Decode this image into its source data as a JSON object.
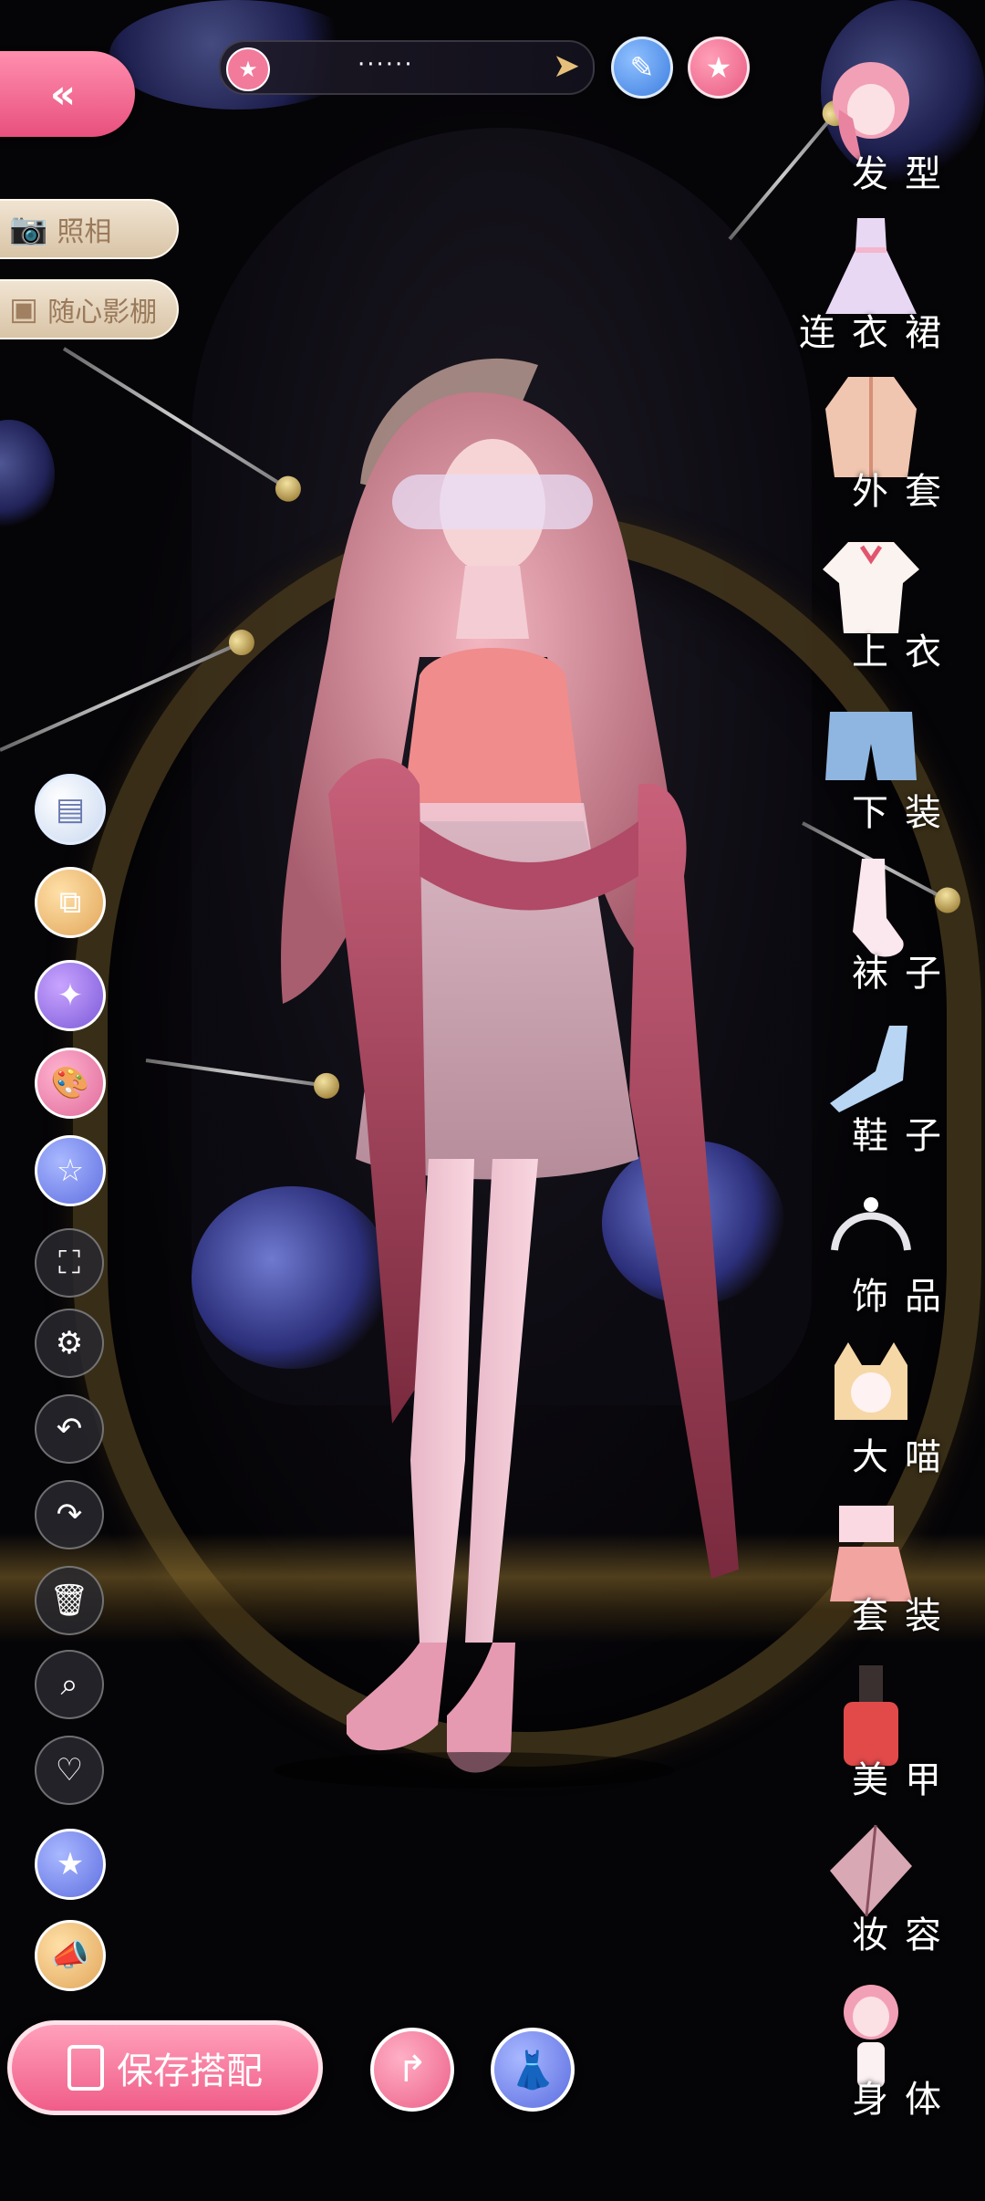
{
  "top_bar": {
    "back_icon": "«",
    "star_icon": "★",
    "outfit_name": "······",
    "arrow_icon": "➤",
    "edit_icon": "✎",
    "favorite_icon": "★"
  },
  "left_buttons": {
    "photo_label": "照相",
    "studio_label": "随心影棚",
    "camera_icon": "📷",
    "box_icon": "▣"
  },
  "tools": [
    {
      "icon": "▤",
      "name": "preset-icon"
    },
    {
      "icon": "⧉",
      "name": "layers-icon"
    },
    {
      "icon": "✦",
      "name": "search-sparkle-icon"
    },
    {
      "icon": "🎨",
      "name": "palette-icon"
    },
    {
      "icon": "☆",
      "name": "pose-icon"
    },
    {
      "icon": "⛶",
      "name": "fullscreen-icon"
    },
    {
      "icon": "⚙",
      "name": "gear-icon"
    },
    {
      "icon": "↶",
      "name": "undo-icon"
    },
    {
      "icon": "↷",
      "name": "redo-icon"
    },
    {
      "icon": "🗑",
      "name": "trash-icon"
    },
    {
      "icon": "⌕",
      "name": "zoom-icon"
    },
    {
      "icon": "♡",
      "name": "heart-icon"
    },
    {
      "icon": "★",
      "name": "star-badge-icon"
    },
    {
      "icon": "📣",
      "name": "megaphone-icon"
    }
  ],
  "bottom": {
    "save_label": "保存搭配",
    "share_icon": "↱",
    "outfit_icon": "👗"
  },
  "categories": [
    {
      "label": "发型"
    },
    {
      "label": "连衣裙"
    },
    {
      "label": "外套"
    },
    {
      "label": "上衣"
    },
    {
      "label": "下装"
    },
    {
      "label": "袜子"
    },
    {
      "label": "鞋子"
    },
    {
      "label": "饰品"
    },
    {
      "label": "大喵"
    },
    {
      "label": "套装"
    },
    {
      "label": "美甲"
    },
    {
      "label": "妆容"
    },
    {
      "label": "身体"
    }
  ],
  "colors": {
    "accent_pink": "#f05d88",
    "tool_purple": "#7b5ad8",
    "tool_blue": "#5f6fe0",
    "tool_gold": "#e1a65a",
    "pill_beige": "#d9c4a6"
  }
}
